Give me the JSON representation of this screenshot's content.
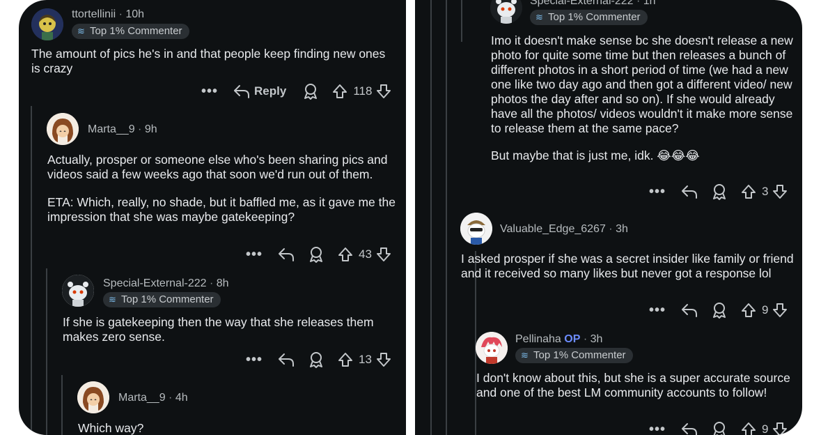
{
  "left": {
    "comment1": {
      "username": "ttortellinii",
      "time": "10h",
      "badge": "Top 1% Commenter",
      "body": "The amount of pics he's in and that people keep finding new ones is crazy",
      "reply_label": "Reply",
      "votes": "118"
    },
    "comment2": {
      "username": "Marta__9",
      "time": "9h",
      "body_p1": "Actually, prosper or someone else who's been sharing pics and videos said a few weeks ago that soon we'd run out of them.",
      "body_p2": "ETA: Which, really, no shade, but it baffled me, as it gave me the impression that she was maybe gatekeeping?",
      "votes": "43"
    },
    "comment3": {
      "username": "Special-External-222",
      "time": "8h",
      "badge": "Top 1% Commenter",
      "body": "If she is gatekeeping then the way that she releases them makes zero sense.",
      "votes": "13"
    },
    "comment4": {
      "username": "Marta__9",
      "time": "4h",
      "body": "Which way?"
    }
  },
  "right": {
    "comment1": {
      "username": "Special-External-222",
      "time": "1h",
      "badge": "Top 1% Commenter",
      "body_p1": "Imo it doesn't make sense bc she doesn't release a new photo for quite some time but then releases a bunch of different photos in a short period of time (we had a new one like two day ago and then got a different video/ new photos the day after and so on). If she would already have all the photos/ videos wouldn't it make more sense to release them at the same pace?",
      "body_p2": "But maybe that is just me, idk. 😂😂😂",
      "votes": "3"
    },
    "comment2": {
      "username": "Valuable_Edge_6267",
      "time": "3h",
      "body": "I asked prosper if she was a secret insider like family or friend and it received so many likes but never got a response lol",
      "votes": "9"
    },
    "comment3": {
      "username": "Pellinaha",
      "op_label": "OP",
      "time": "3h",
      "badge": "Top 1% Commenter",
      "body": "I don't know about this, but she is a super accurate source and one of the best LM community accounts to follow!",
      "votes": "9"
    }
  },
  "icons": [
    "more-icon",
    "reply-icon",
    "award-icon",
    "upvote-icon",
    "downvote-icon",
    "top-commenter-icon",
    "avatar"
  ]
}
